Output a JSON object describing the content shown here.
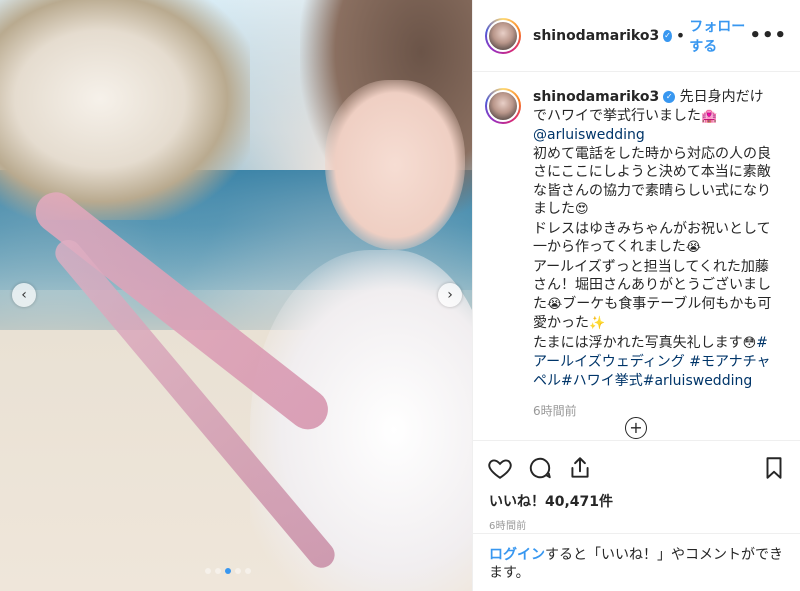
{
  "post": {
    "username": "shinodamariko3",
    "follow_label": "フォローする",
    "separator": "•",
    "more_icon": "•••",
    "verified_mark": "✓"
  },
  "caption": {
    "username": "shinodamariko3",
    "text_1": " 先日身内だけでハワイで挙式行いました",
    "emoji_house": "🏩",
    "mention": "@arluiswedding",
    "text_2": "初めて電話をした時から対応の人の良さにここにしようと決めて本当に素敵な皆さんの協力で素晴らしい式になりました",
    "emoji_heart_eyes": "😍",
    "text_3": "ドレスはゆきみちゃんがお祝いとして一から作ってくれました",
    "emoji_cry": "😭",
    "text_4": "アールイズずっと担当してくれた加藤さん！堀田さんありがとうございました",
    "emoji_cry2": "😭",
    "text_5": "ブーケも食事テーブル何もかも可愛かった",
    "emoji_sparkle": "✨",
    "text_6": "たまには浮かれた写真失礼します",
    "emoji_sweat": "😳",
    "hashtags": "#アールイズウェディング #モアナチャペル#ハワイ挙式#arluiswedding",
    "time_ago": "6時間前"
  },
  "actions": {
    "likes_label": "いいね！40,471件",
    "post_time": "6時間前",
    "load_more_symbol": "+"
  },
  "login": {
    "login_link": "ログイン",
    "rest": "すると「いいね！」やコメントができます。"
  },
  "carousel": {
    "prev_symbol": "‹",
    "next_symbol": "›",
    "dot_count": 5,
    "active_dot_index": 2
  },
  "colors": {
    "link": "#003569",
    "accent": "#3897f0"
  }
}
